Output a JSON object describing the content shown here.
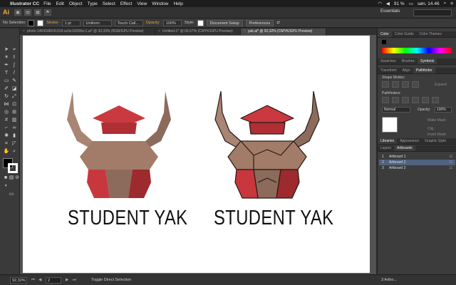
{
  "menubar": {
    "app": "Illustrator CC",
    "items": [
      "File",
      "Edit",
      "Object",
      "Type",
      "Select",
      "Effect",
      "View",
      "Window",
      "Help"
    ],
    "battery": "91 %",
    "clock": "søn. 14.46"
  },
  "appbar": {
    "logo": "Ai",
    "workspace": "Essentials"
  },
  "controlbar": {
    "selection": "No Selection",
    "stroke_label": "Stroke:",
    "stroke_value": "1 pt",
    "profile": "Uniform",
    "brush": "Touch Call...",
    "opacity_label": "Opacity:",
    "opacity_value": "100%",
    "style_label": "Style:",
    "doc_setup": "Document Setup",
    "preferences": "Preferences",
    "fill_color": "#000000",
    "stroke_color": "#ffffff"
  },
  "tabs": [
    {
      "label": "photo-1464188241319-ac6e10699cc1.ai* @ 33,33% (RGB/GPU Preview)",
      "active": false
    },
    {
      "label": "Untitled-1* @ 66,67% (CMYK/GPU Preview)",
      "active": false
    },
    {
      "label": "yak.ai* @ 92,32% (CMYK/GPU Preview)",
      "active": true
    }
  ],
  "artboard": {
    "left_caption": "STUDENT YAK",
    "right_caption": "STUDENT YAK"
  },
  "panel": {
    "color_tabs": [
      "Color",
      "Color Guide",
      "Color Themes"
    ],
    "swatch_tabs": [
      "Swatches",
      "Brushes",
      "Symbols"
    ],
    "transform_tabs": [
      "Transform",
      "Align",
      "Pathfinder"
    ],
    "shape_modes": "Shape Modes:",
    "expand": "Expand",
    "pathfinders": "Pathfinders:",
    "blend_mode": "Normal",
    "opacity_label": "Opacity:",
    "opacity_value": "100%",
    "make_mask": "Make Mask",
    "clip": "Clip",
    "invert_mask": "Invert Mask",
    "lib_tabs": [
      "Libraries",
      "Appearance",
      "Graphic Style"
    ],
    "layer_tabs": [
      "Layers",
      "Artboards"
    ],
    "artboards": [
      {
        "num": "1",
        "name": "Artboard 1",
        "selected": false
      },
      {
        "num": "2",
        "name": "Artboard 2",
        "selected": true
      },
      {
        "num": "3",
        "name": "Artboard 3",
        "selected": false
      }
    ]
  },
  "statusbar": {
    "zoom": "92,32%",
    "page": "2",
    "status": "Toggle Direct Selection",
    "artboard_count": "3 Artbo..."
  },
  "colors": {
    "horn": "#a98574",
    "horn_dark": "#8c6b5c",
    "body_red": "#c8373d",
    "body_red_dark": "#9d2a2f",
    "cap": "#c9393f",
    "cap_top": "#b02f34",
    "face": "#a27c68",
    "outline": "#2a1a14"
  }
}
